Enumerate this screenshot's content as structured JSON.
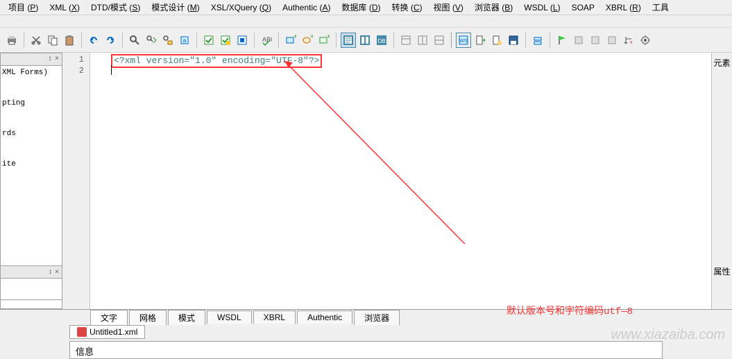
{
  "menu": {
    "items": [
      {
        "label": "项目",
        "accel": "P"
      },
      {
        "label": "XML",
        "accel": "X"
      },
      {
        "label": "DTD/模式",
        "accel": "S"
      },
      {
        "label": "模式设计",
        "accel": "M"
      },
      {
        "label": "XSL/XQuery",
        "accel": "Q"
      },
      {
        "label": "Authentic",
        "accel": "A"
      },
      {
        "label": "数据库",
        "accel": "D"
      },
      {
        "label": "转换",
        "accel": "C"
      },
      {
        "label": "视图",
        "accel": "V"
      },
      {
        "label": "浏览器",
        "accel": "B"
      },
      {
        "label": "WSDL",
        "accel": "L"
      },
      {
        "label": "SOAP",
        "accel": ""
      },
      {
        "label": "XBRL",
        "accel": "R"
      },
      {
        "label": "工具",
        "accel": ""
      }
    ]
  },
  "toolbar_icons": [
    "print-icon",
    "cut-icon",
    "copy-icon",
    "paste-icon",
    "undo-icon",
    "redo-icon",
    "find-icon",
    "find-next-icon",
    "replace-icon",
    "bookmark-icon",
    "validate-icon",
    "validate-selection-icon",
    "validate-file-icon",
    "spellcheck-icon",
    "new-element-icon",
    "new-attr-icon",
    "new-text-icon",
    "view-text-icon",
    "view-grid-icon",
    "view-schema-icon",
    "view-db-icon",
    "layout1-icon",
    "layout2-icon",
    "layout3-icon",
    "transform-icon",
    "export-icon",
    "open-icon",
    "save-icon",
    "refresh-icon",
    "flag-icon",
    "bar1-icon",
    "bar2-icon",
    "bar3-icon",
    "sort-icon",
    "settings-icon"
  ],
  "left_panel": {
    "pin": "↕",
    "close": "×",
    "tree_items": [
      "XML Forms)",
      "pting",
      "rds",
      "ite"
    ]
  },
  "editor": {
    "line_numbers": [
      "1",
      "2"
    ],
    "xml_declaration": "<?xml version=\"1.0\" encoding=\"UTF-8\"?>"
  },
  "annotation_text": "默认版本号和字符编码utf—8",
  "right_rail": {
    "top": "元素",
    "bottom": "属性"
  },
  "bottom_tabs": [
    "文字",
    "网格",
    "模式",
    "WSDL",
    "XBRL",
    "Authentic",
    "浏览器"
  ],
  "active_bottom_tab": 0,
  "file_tab": "Untitled1.xml",
  "info_label": "信息",
  "watermark": "www.xiazaiba.com"
}
